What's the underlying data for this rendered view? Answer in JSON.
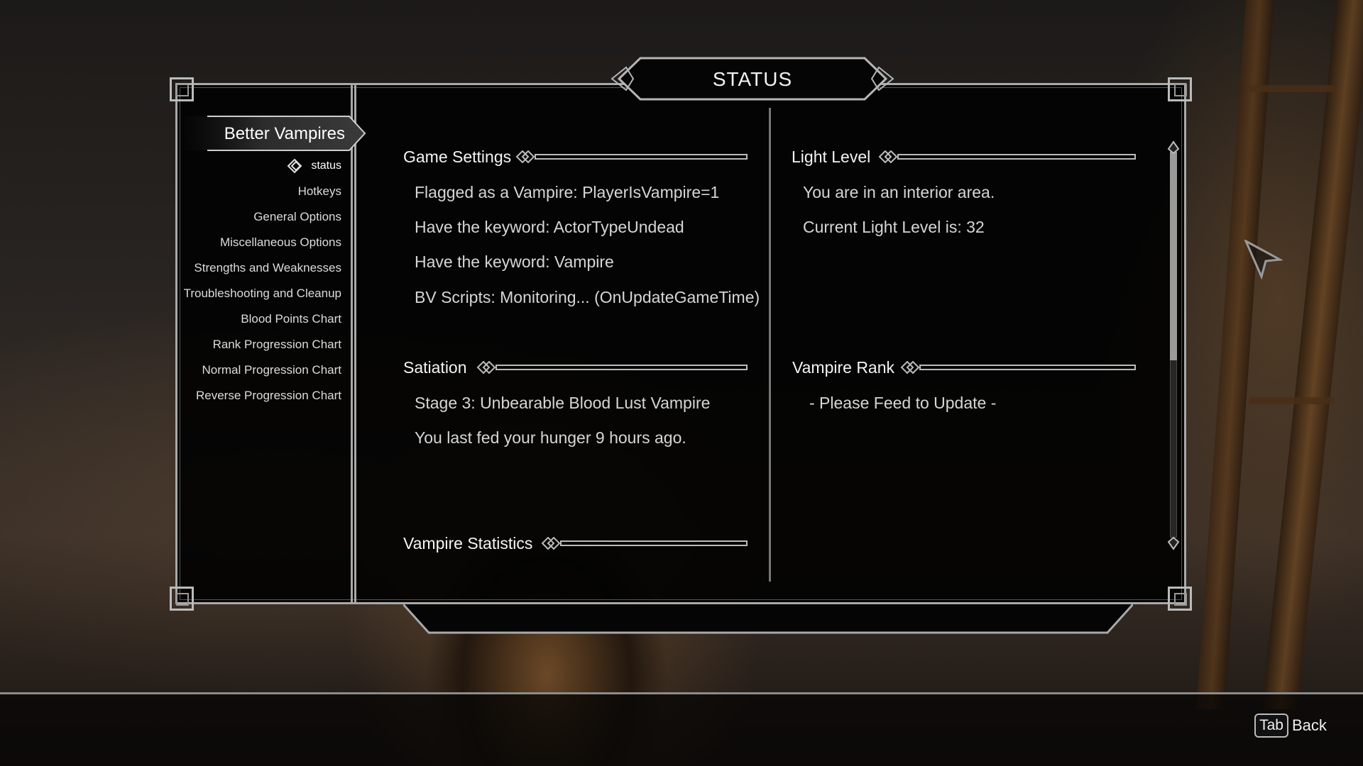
{
  "menu": {
    "title": "STATUS",
    "mod_name": "Better Vampires",
    "pages": [
      "status",
      "Hotkeys",
      "General Options",
      "Miscellaneous Options",
      "Strengths and Weaknesses",
      "Troubleshooting and Cleanup",
      "Blood Points Chart",
      "Rank Progression Chart",
      "Normal Progression Chart",
      "Reverse Progression Chart"
    ],
    "active_page": "status"
  },
  "left_column": {
    "game_settings": {
      "header": "Game Settings",
      "rows": [
        "Flagged as a Vampire: PlayerIsVampire=1",
        "Have the keyword: ActorTypeUndead",
        "Have the keyword: Vampire",
        "BV Scripts: Monitoring... (OnUpdateGameTime)"
      ]
    },
    "satiation": {
      "header": "Satiation",
      "rows": [
        "Stage 3: Unbearable Blood Lust Vampire",
        "You last fed your hunger 9 hours ago."
      ]
    },
    "vampire_statistics": {
      "header": "Vampire Statistics"
    }
  },
  "right_column": {
    "light_level": {
      "header": "Light Level",
      "rows": [
        "You are in an interior area.",
        "Current Light Level is: 32"
      ]
    },
    "vampire_rank": {
      "header": "Vampire Rank",
      "rows": [
        "- Please Feed to Update -"
      ]
    }
  },
  "scrollbar": {
    "position_fraction": 0.0,
    "visible_fraction": 0.54
  },
  "footer": {
    "back_key": "Tab",
    "back_label": "Back"
  },
  "icons": [
    "knot-ornament-icon",
    "scroll-up-icon",
    "scroll-down-icon",
    "mouse-cursor-icon"
  ]
}
